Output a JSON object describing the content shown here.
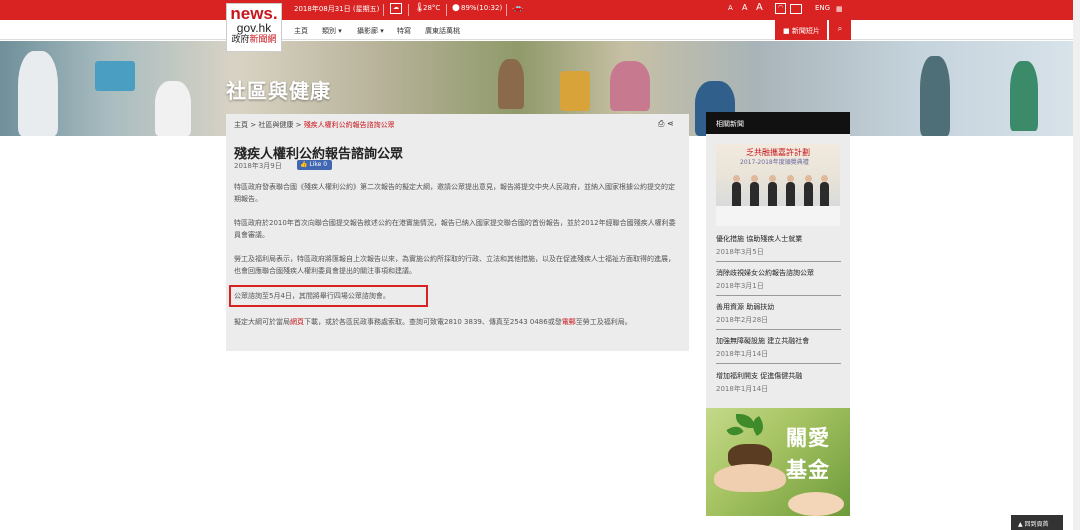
{
  "logo": {
    "line1": "news.",
    "line2": "gov.hk",
    "line3a": "政府",
    "line3b": "新聞網"
  },
  "topbar": {
    "date": "2018年08月31日 (星期五)",
    "temperature": "28°C",
    "humidity": "89%(10:32)",
    "font_sizes": [
      "A",
      "A",
      "A"
    ],
    "language": "ENG"
  },
  "nav": {
    "items": [
      "主頁",
      "類別",
      "攝影廊",
      "特寫",
      "廣東話萬桃"
    ],
    "gallery_label": "新聞短片"
  },
  "banner": {
    "title": "社區與健康"
  },
  "breadcrumb": {
    "home": "主頁",
    "sep": ">",
    "section": "社區與健康",
    "current": "殘疾人權利公約報告諮詢公眾"
  },
  "article": {
    "title": "殘疾人權利公約報告諮詢公眾",
    "date": "2018年3月9日",
    "like_label": "Like 0",
    "paragraphs": [
      "特區政府發表聯合國《殘疾人權利公約》第二次報告的擬定大綱，邀請公眾提出意見，報告將提交中央人民政府，並納入國家根據公約提交的定期報告。",
      "特區政府於2010年首次向聯合國提交報告敘述公約在港實施情況，報告已納入國家提交聯合國的首份報告，並於2012年經聯合國殘疾人權利委員會審議。",
      "勞工及福利局表示，特區政府將匯報自上次報告以來，為實施公約所採取的行政、立法和其他措施，以及在促進殘疾人士福祉方面取得的進展，也會回應聯合國殘疾人權利委員會提出的關注事項和建議。",
      "公眾諮詢至5月4日，其間將舉行四場公眾諮詢會。"
    ],
    "last_para": {
      "t1": "擬定大綱可於當局",
      "link1": "網頁",
      "t2": "下載，或於各區民政事務處索取。查詢可致電2810 3839、傳真至2543 0486或發",
      "link2": "電郵",
      "t3": "至勞工及福利局。"
    }
  },
  "related": {
    "heading": "相關新聞",
    "image_caption1": "乏共融攜嘉許計劃",
    "image_caption2": "2017-2018年度頒獎典禮",
    "items": [
      {
        "title": "優化措施 協助殘疾人士就業",
        "date": "2018年3月5日"
      },
      {
        "title": "消除歧視婦女公約報告諮詢公眾",
        "date": "2018年3月1日"
      },
      {
        "title": "善用資源 助弱扶幼",
        "date": "2018年2月28日"
      },
      {
        "title": "加強無障礙設施 建立共融社會",
        "date": "2018年1月14日"
      },
      {
        "title": "增加福利開支 促進傷健共融",
        "date": "2018年1月14日"
      }
    ]
  },
  "fund": {
    "line1": "關愛",
    "line2": "基金"
  },
  "back_to_top": "▲ 回到頁首",
  "colors": {
    "brand_red": "#d92323",
    "content_bg": "#ececec",
    "dark": "#111111"
  }
}
